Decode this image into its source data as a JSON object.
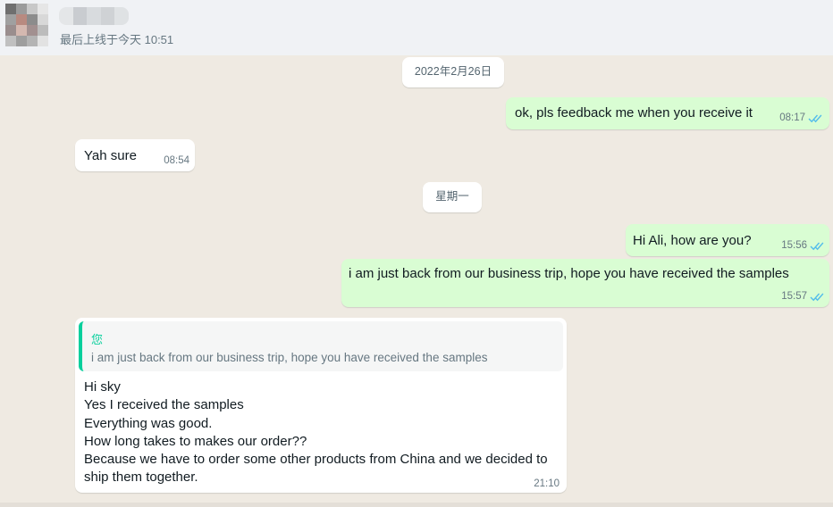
{
  "header": {
    "contact_name": "",
    "last_seen": "最后上线于今天 10:51"
  },
  "messages": [
    {
      "type": "date",
      "text": "2022年2月26日"
    },
    {
      "type": "outgoing",
      "text": "ok, pls feedback me when you receive it",
      "time": "08:17",
      "status": "read"
    },
    {
      "type": "incoming",
      "text": "Yah sure",
      "time": "08:54"
    },
    {
      "type": "date",
      "text": "星期一"
    },
    {
      "type": "outgoing",
      "text": "Hi Ali, how are you?",
      "time": "15:56",
      "status": "read"
    },
    {
      "type": "outgoing",
      "text": "i am just back from our business trip, hope you have received the samples",
      "time": "15:57",
      "status": "read"
    },
    {
      "type": "incoming",
      "quote": {
        "author": "您",
        "text": "i am just back from our business trip, hope you have received the samples"
      },
      "text": "Hi sky\nYes I received the samples\nEverything was good.\nHow long takes to makes our order??\nBecause we have to order some other products from China and we decided to\nship them together.",
      "time": "21:10"
    }
  ],
  "colors": {
    "chat_background": "#efeae2",
    "outgoing_bubble": "#d9fdd3",
    "incoming_bubble": "#ffffff",
    "read_tick": "#53bdeb",
    "quote_accent": "#06cf9c"
  },
  "icons": {
    "avatar": "pixelated-avatar",
    "status": "double-check-icon"
  }
}
